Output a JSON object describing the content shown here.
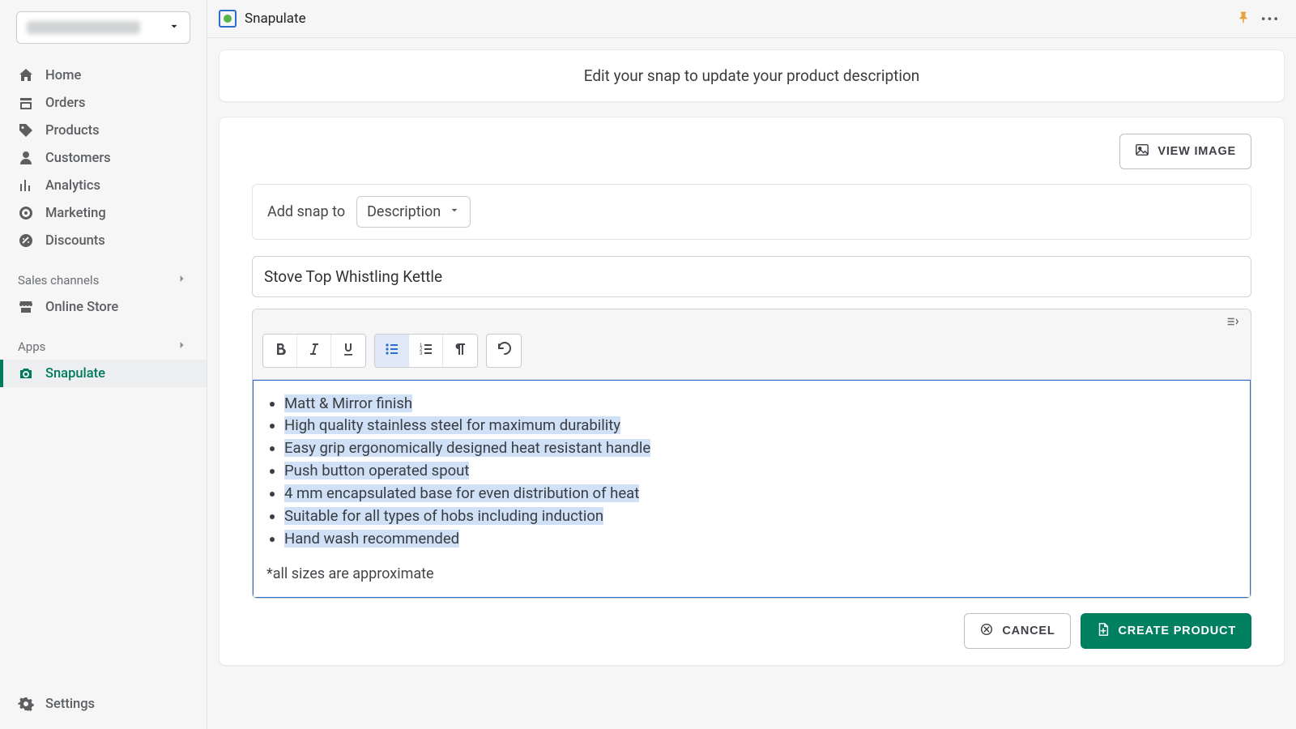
{
  "sidebar": {
    "items": [
      {
        "label": "Home"
      },
      {
        "label": "Orders"
      },
      {
        "label": "Products"
      },
      {
        "label": "Customers"
      },
      {
        "label": "Analytics"
      },
      {
        "label": "Marketing"
      },
      {
        "label": "Discounts"
      }
    ],
    "section_sales": "Sales channels",
    "online_store": "Online Store",
    "section_apps": "Apps",
    "app_active": "Snapulate",
    "settings": "Settings"
  },
  "topbar": {
    "app_name": "Snapulate"
  },
  "banner": {
    "text": "Edit your snap to update your product description"
  },
  "editor": {
    "view_image": "VIEW IMAGE",
    "add_snap_label": "Add snap to",
    "add_snap_select": "Description",
    "title": "Stove Top Whistling Kettle",
    "bullets": [
      "Matt & Mirror finish",
      "High quality stainless steel for maximum durability",
      "Easy grip ergonomically designed heat resistant handle",
      "Push button operated spout",
      "4 mm encapsulated base for even distribution of heat",
      "Suitable for all types of hobs including induction",
      "Hand wash recommended"
    ],
    "footnote": "*all sizes are approximate",
    "cancel": "CANCEL",
    "create": "CREATE PRODUCT"
  }
}
